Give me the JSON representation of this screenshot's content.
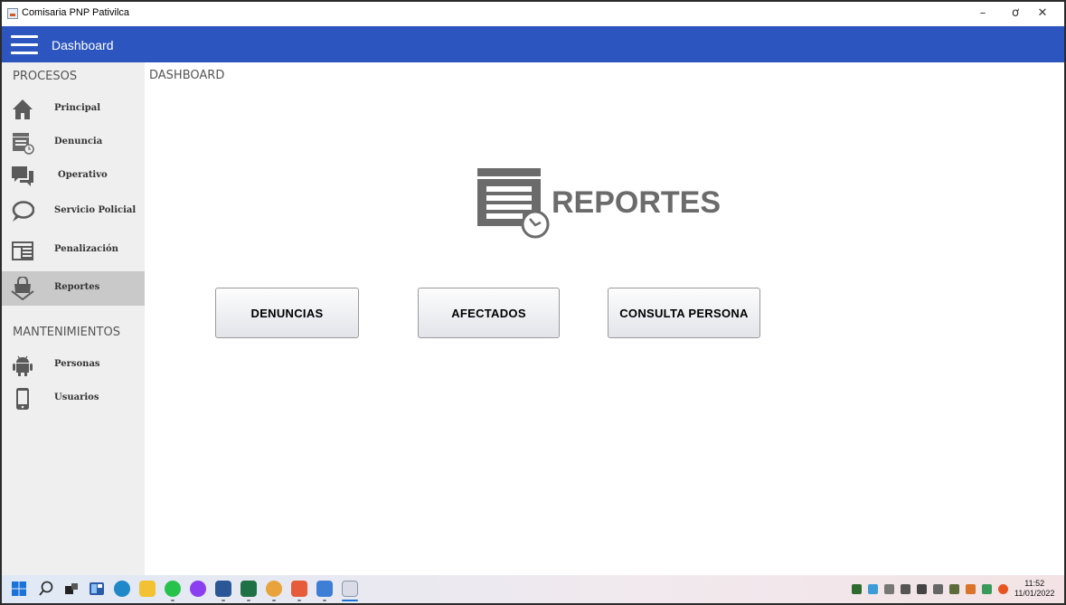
{
  "window": {
    "title": "Comisaria PNP Pativilca",
    "minimize": "–",
    "maximize": "ơ",
    "close": "✕"
  },
  "header": {
    "title": "Dashboard"
  },
  "sidebar": {
    "procesos_title": "PROCESOS",
    "procesos": [
      {
        "label": "Principal",
        "icon": "home-icon"
      },
      {
        "label": "Denuncia",
        "icon": "report-clock-icon"
      },
      {
        "label": "Operativo",
        "icon": "chat-bubbles-icon"
      },
      {
        "label": "Servicio Policial",
        "icon": "speech-bubble-icon"
      },
      {
        "label": "Penalización",
        "icon": "newspaper-icon"
      },
      {
        "label": "Reportes",
        "icon": "shopping-bag-icon",
        "active": true
      }
    ],
    "mantenimientos_title": "MANTENIMIENTOS",
    "mantenimientos": [
      {
        "label": "Personas",
        "icon": "android-icon"
      },
      {
        "label": "Usuarios",
        "icon": "phone-icon"
      }
    ]
  },
  "main": {
    "breadcrumb": "DASHBOARD",
    "hero_title": "REPORTES",
    "buttons": [
      {
        "label": "DENUNCIAS"
      },
      {
        "label": "AFECTADOS"
      },
      {
        "label": "CONSULTA PERSONA"
      }
    ]
  },
  "taskbar": {
    "time": "11:52",
    "date": "11/01/2022",
    "colors": {
      "header_blue": "#2c55bf",
      "active_item": "#c9c9c9",
      "sidebar_bg": "#efefef"
    }
  }
}
